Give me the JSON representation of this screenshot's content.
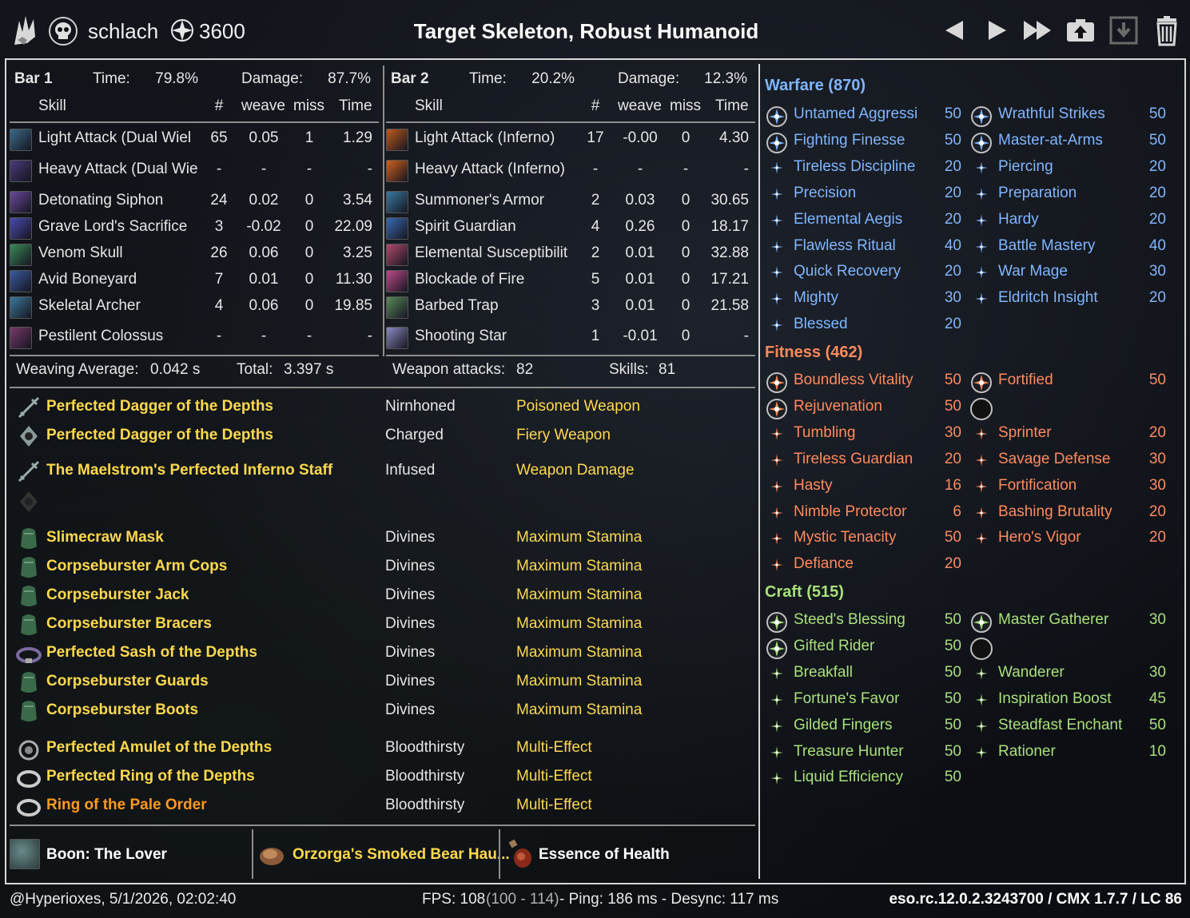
{
  "header": {
    "player_name": "schlach",
    "champion_points": "3600",
    "title": "Target Skeleton, Robust Humanoid"
  },
  "bar1": {
    "label": "Bar 1",
    "time_label": "Time:",
    "time": "79.8%",
    "damage_label": "Damage:",
    "damage": "87.7%",
    "col_skill": "Skill",
    "col_count": "#",
    "col_weave": "weave",
    "col_miss": "miss",
    "col_time": "Time",
    "rows": [
      {
        "skill": "Light Attack (Dual Wiel",
        "count": "65",
        "weave": "0.05",
        "miss": "1",
        "time": "1.29",
        "icon": "dual-wield-icon",
        "color": "#3a6a8a"
      },
      {
        "skill": "Heavy Attack (Dual Wie",
        "count": "-",
        "weave": "-",
        "miss": "-",
        "time": "-",
        "icon": "dual-wield-heavy-icon",
        "color": "#4a3a7a"
      },
      {
        "skill": "Detonating Siphon",
        "count": "24",
        "weave": "0.02",
        "miss": "0",
        "time": "3.54",
        "icon": "siphon-icon",
        "color": "#6a4a9a"
      },
      {
        "skill": "Grave Lord's Sacrifice",
        "count": "3",
        "weave": "-0.02",
        "miss": "0",
        "time": "22.09",
        "icon": "sacrifice-icon",
        "color": "#4a4ab0"
      },
      {
        "skill": "Venom Skull",
        "count": "26",
        "weave": "0.06",
        "miss": "0",
        "time": "3.25",
        "icon": "venom-skull-icon",
        "color": "#3a8a5a"
      },
      {
        "skill": "Avid Boneyard",
        "count": "7",
        "weave": "0.01",
        "miss": "0",
        "time": "11.30",
        "icon": "boneyard-icon",
        "color": "#3a5aa0"
      },
      {
        "skill": "Skeletal Archer",
        "count": "4",
        "weave": "0.06",
        "miss": "0",
        "time": "19.85",
        "icon": "archer-icon",
        "color": "#3a7a9a"
      },
      {
        "skill": "Pestilent Colossus",
        "count": "-",
        "weave": "-",
        "miss": "-",
        "time": "-",
        "icon": "colossus-icon",
        "color": "#7a3a6a"
      }
    ]
  },
  "bar2": {
    "label": "Bar 2",
    "time_label": "Time:",
    "time": "20.2%",
    "damage_label": "Damage:",
    "damage": "12.3%",
    "col_skill": "Skill",
    "col_count": "#",
    "col_weave": "weave",
    "col_miss": "miss",
    "col_time": "Time",
    "rows": [
      {
        "skill": "Light Attack (Inferno)",
        "count": "17",
        "weave": "-0.00",
        "miss": "0",
        "time": "4.30",
        "icon": "inferno-light-icon",
        "color": "#c05a1a"
      },
      {
        "skill": "Heavy Attack (Inferno)",
        "count": "-",
        "weave": "-",
        "miss": "-",
        "time": "-",
        "icon": "inferno-heavy-icon",
        "color": "#d0601a"
      },
      {
        "skill": "Summoner's Armor",
        "count": "2",
        "weave": "0.03",
        "miss": "0",
        "time": "30.65",
        "icon": "armor-icon",
        "color": "#3a7aa0"
      },
      {
        "skill": "Spirit Guardian",
        "count": "4",
        "weave": "0.26",
        "miss": "0",
        "time": "18.17",
        "icon": "guardian-icon",
        "color": "#3a6ab0"
      },
      {
        "skill": "Elemental Susceptibilit",
        "count": "2",
        "weave": "0.01",
        "miss": "0",
        "time": "32.88",
        "icon": "susceptibility-icon",
        "color": "#b04a6a"
      },
      {
        "skill": "Blockade of Fire",
        "count": "5",
        "weave": "0.01",
        "miss": "0",
        "time": "17.21",
        "icon": "blockade-icon",
        "color": "#c04a8a"
      },
      {
        "skill": "Barbed Trap",
        "count": "3",
        "weave": "0.01",
        "miss": "0",
        "time": "21.58",
        "icon": "trap-icon",
        "color": "#5a8a5a"
      },
      {
        "skill": "Shooting Star",
        "count": "1",
        "weave": "-0.01",
        "miss": "0",
        "time": "-",
        "icon": "shooting-star-icon",
        "color": "#8a8ac0"
      }
    ]
  },
  "summary": {
    "weaving_label": "Weaving Average:",
    "weaving": "0.042 s",
    "total_label": "Total:",
    "total": "3.397 s",
    "weapon_label": "Weapon attacks:",
    "weapon": "82",
    "skills_label": "Skills:",
    "skills": "81"
  },
  "gear": [
    {
      "name": "Perfected Dagger of the Depths",
      "trait": "Nirnhoned",
      "enchant": "Poisoned Weapon",
      "icon": "dagger-icon",
      "quality": "legendary"
    },
    {
      "name": "Perfected Dagger of the Depths",
      "trait": "Charged",
      "enchant": "Fiery Weapon",
      "icon": "offhand-dagger-icon",
      "quality": "legendary"
    },
    {
      "name": "The Maelstrom's Perfected Inferno Staff",
      "trait": "Infused",
      "enchant": "Weapon Damage",
      "icon": "staff-icon",
      "quality": "legendary"
    },
    {
      "name": "",
      "trait": "",
      "enchant": "",
      "icon": "empty-offhand-icon",
      "quality": "none"
    },
    {
      "name": "Slimecraw Mask",
      "trait": "Divines",
      "enchant": "Maximum Stamina",
      "icon": "helmet-icon",
      "quality": "legendary"
    },
    {
      "name": "Corpseburster Arm Cops",
      "trait": "Divines",
      "enchant": "Maximum Stamina",
      "icon": "shoulders-icon",
      "quality": "legendary"
    },
    {
      "name": "Corpseburster Jack",
      "trait": "Divines",
      "enchant": "Maximum Stamina",
      "icon": "chest-icon",
      "quality": "legendary"
    },
    {
      "name": "Corpseburster Bracers",
      "trait": "Divines",
      "enchant": "Maximum Stamina",
      "icon": "gloves-icon",
      "quality": "legendary"
    },
    {
      "name": "Perfected Sash of the Depths",
      "trait": "Divines",
      "enchant": "Maximum Stamina",
      "icon": "belt-icon",
      "quality": "legendary"
    },
    {
      "name": "Corpseburster Guards",
      "trait": "Divines",
      "enchant": "Maximum Stamina",
      "icon": "legs-icon",
      "quality": "legendary"
    },
    {
      "name": "Corpseburster Boots",
      "trait": "Divines",
      "enchant": "Maximum Stamina",
      "icon": "boots-icon",
      "quality": "legendary"
    },
    {
      "name": "Perfected Amulet of the Depths",
      "trait": "Bloodthirsty",
      "enchant": "Multi-Effect",
      "icon": "amulet-icon",
      "quality": "legendary"
    },
    {
      "name": "Perfected Ring of the Depths",
      "trait": "Bloodthirsty",
      "enchant": "Multi-Effect",
      "icon": "ring-icon",
      "quality": "legendary"
    },
    {
      "name": "Ring of the Pale Order",
      "trait": "Bloodthirsty",
      "enchant": "Multi-Effect",
      "icon": "ring-icon",
      "quality": "mythic"
    }
  ],
  "buffs": {
    "boon": "Boon: The Lover",
    "food": "Orzorga's Smoked Bear Hau...",
    "potion": "Essence of Health"
  },
  "cp": {
    "warfare": {
      "title": "Warfare (870)",
      "color": "#7fb6ff",
      "slotted_left": [
        {
          "name": "Untamed Aggressi",
          "value": "50"
        },
        {
          "name": "Fighting Finesse",
          "value": "50"
        }
      ],
      "slotted_right": [
        {
          "name": "Wrathful Strikes",
          "value": "50"
        },
        {
          "name": "Master-at-Arms",
          "value": "50"
        }
      ],
      "left": [
        {
          "name": "Tireless Discipline",
          "value": "20"
        },
        {
          "name": "Precision",
          "value": "20"
        },
        {
          "name": "Elemental Aegis",
          "value": "20"
        },
        {
          "name": "Flawless Ritual",
          "value": "40"
        },
        {
          "name": "Quick Recovery",
          "value": "20"
        },
        {
          "name": "Mighty",
          "value": "30"
        },
        {
          "name": "Blessed",
          "value": "20"
        }
      ],
      "right": [
        {
          "name": "Piercing",
          "value": "20"
        },
        {
          "name": "Preparation",
          "value": "20"
        },
        {
          "name": "Hardy",
          "value": "20"
        },
        {
          "name": "Battle Mastery",
          "value": "40"
        },
        {
          "name": "War Mage",
          "value": "30"
        },
        {
          "name": "Eldritch Insight",
          "value": "20"
        }
      ]
    },
    "fitness": {
      "title": "Fitness (462)",
      "color": "#ff8a5c",
      "slotted_left": [
        {
          "name": "Boundless Vitality",
          "value": "50"
        },
        {
          "name": "Rejuvenation",
          "value": "50"
        }
      ],
      "slotted_right": [
        {
          "name": "Fortified",
          "value": "50"
        },
        {
          "name": "",
          "value": ""
        }
      ],
      "left": [
        {
          "name": "Tumbling",
          "value": "30"
        },
        {
          "name": "Tireless Guardian",
          "value": "20"
        },
        {
          "name": "Hasty",
          "value": "16"
        },
        {
          "name": "Nimble Protector",
          "value": "6"
        },
        {
          "name": "Mystic Tenacity",
          "value": "50"
        },
        {
          "name": "Defiance",
          "value": "20"
        }
      ],
      "right": [
        {
          "name": "Sprinter",
          "value": "20"
        },
        {
          "name": "Savage Defense",
          "value": "30"
        },
        {
          "name": "Fortification",
          "value": "30"
        },
        {
          "name": "Bashing Brutality",
          "value": "20"
        },
        {
          "name": "Hero's Vigor",
          "value": "20"
        }
      ]
    },
    "craft": {
      "title": "Craft (515)",
      "color": "#a8e07a",
      "slotted_left": [
        {
          "name": "Steed's Blessing",
          "value": "50"
        },
        {
          "name": "Gifted Rider",
          "value": "50"
        }
      ],
      "slotted_right": [
        {
          "name": "Master Gatherer",
          "value": "30"
        },
        {
          "name": "",
          "value": ""
        }
      ],
      "left": [
        {
          "name": "Breakfall",
          "value": "50"
        },
        {
          "name": "Fortune's Favor",
          "value": "50"
        },
        {
          "name": "Gilded Fingers",
          "value": "50"
        },
        {
          "name": "Treasure Hunter",
          "value": "50"
        },
        {
          "name": "Liquid Efficiency",
          "value": "50"
        }
      ],
      "right": [
        {
          "name": "Wanderer",
          "value": "30"
        },
        {
          "name": "Inspiration Boost",
          "value": "45"
        },
        {
          "name": "Steadfast Enchant",
          "value": "50"
        },
        {
          "name": "Rationer",
          "value": "10"
        }
      ]
    }
  },
  "footer": {
    "user_time": "@Hyperioxes, 5/1/2026, 02:02:40",
    "fps_label": "FPS: 108",
    "fps_range": "(100 - 114)",
    "ping": "- Ping: 186 ms - Desync: 117 ms",
    "version": "eso.rc.12.0.2.3243700 / CMX 1.7.7 / LC 86"
  },
  "colors": {
    "gold": "#ffd94d",
    "orange": "#ff9a1f",
    "warfare": "#7fb6ff",
    "fitness": "#ff8a5c",
    "craft": "#a8e07a"
  }
}
